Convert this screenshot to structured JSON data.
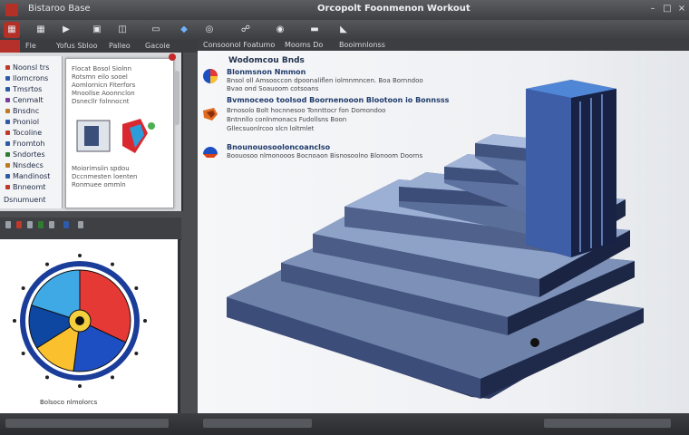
{
  "titlebar": {
    "app_title": "Bistaroo Base",
    "window_title": "Orcopolt Foonmenon Workout"
  },
  "ribbon": {
    "buttons": [
      {
        "icon": "app-menu-icon"
      },
      {
        "icon": "grid-icon"
      },
      {
        "icon": "play-icon"
      },
      {
        "icon": "save-icon"
      },
      {
        "icon": "model-icon"
      },
      {
        "icon": "drawing-icon"
      },
      {
        "icon": "shape-icon"
      },
      {
        "icon": "globe-icon"
      },
      {
        "icon": "link-icon"
      },
      {
        "icon": "view-icon"
      },
      {
        "icon": "ruler-icon"
      },
      {
        "icon": "component-icon"
      }
    ]
  },
  "menubar": {
    "items": [
      "Fle",
      "Yofus Sbloo",
      "Palleo",
      "Gacoie"
    ]
  },
  "tree": {
    "items": [
      {
        "label": "Noonsl trs",
        "color": "#c0392b"
      },
      {
        "label": "Ilorncrons",
        "color": "#2e5aa8"
      },
      {
        "label": "Tmsrtos",
        "color": "#2e5aa8"
      },
      {
        "label": "Cenmalt",
        "color": "#7a3d9c"
      },
      {
        "label": "Bnsdnc",
        "color": "#c07a24"
      },
      {
        "label": "Pnoniol",
        "color": "#2e5aa8"
      },
      {
        "label": "Tocoline",
        "color": "#c0392b"
      },
      {
        "label": "Fnomtoh",
        "color": "#2e5aa8"
      },
      {
        "label": "Sndortes",
        "color": "#2e7d32"
      },
      {
        "label": "Nnsdecs",
        "color": "#c07a24"
      },
      {
        "label": "Mandinost",
        "color": "#2e5aa8"
      },
      {
        "label": "Bnneomt",
        "color": "#c0392b"
      }
    ],
    "footer": "Dsnumuent"
  },
  "doc": {
    "lines": [
      "Flocat Bosol Siolnn",
      "Rotsmn eilo sooel",
      "Aomlornicn Fiterfors",
      "Mnoollse Aoonnclon",
      "Dsnecllr folnnocnt"
    ],
    "footer_lines": [
      "Moiorimsiin spdou",
      "Dccnmesten loenten",
      "Ronmuee ommln"
    ]
  },
  "left_bottom": {
    "caption": "Bolsoco nlmolorcs"
  },
  "main": {
    "header_items": [
      "Consoonol Foatumo",
      "Mooms Do",
      "Booimnlonss"
    ],
    "title": "Wodomcou Bnds",
    "features": [
      {
        "icon": "pie-chart-icon",
        "heading": "Blonmsnon Nmmon",
        "text": [
          "Bnsol oll Amsooccon dpoonaliflen iolmnmncen. Boa Bornndoo",
          "Bvao ond Soauoom cotsoans"
        ]
      },
      {
        "icon": "gear-part-icon",
        "heading": "Bvmnoceoo toolsod Boornenooon Blootoon io Bonnsss",
        "text": [
          "Brnosolo Bolt hocnnesoo Tonnttocr fon Domondoo",
          "Bntnnllo conlnmonacs Fudollsns Boon",
          "Gllecsuonlrcoo slcn loltmlet"
        ]
      },
      {
        "icon": "globe-part-icon",
        "heading": "Bnounouosooloncoanclso",
        "text": [
          "Boouosoo nlmonooos Bocnoaon Bisnosoolno Blonoom Doorns"
        ]
      }
    ]
  },
  "chart_data": {
    "type": "pie",
    "values": [
      0.32,
      0.2,
      0.14,
      0.14,
      0.2
    ],
    "colors": [
      "#e53935",
      "#1e4fc2",
      "#fbc02d",
      "#0d47a1",
      "#3fa9e6"
    ]
  },
  "colors": {
    "accent": "#2e5aa8",
    "titlebar": "#4a4c50",
    "model_blue": "#5a6f9a",
    "model_dark": "#1f2a4a"
  }
}
